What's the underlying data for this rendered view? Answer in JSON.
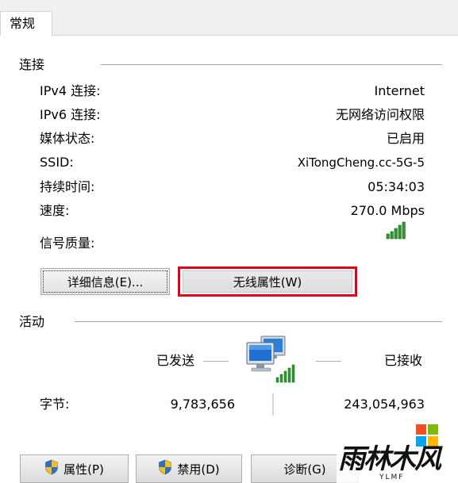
{
  "tab": {
    "label": "常规"
  },
  "connection": {
    "title": "连接",
    "rows": [
      {
        "label": "IPv4 连接:",
        "value": "Internet"
      },
      {
        "label": "IPv6 连接:",
        "value": "无网络访问权限"
      },
      {
        "label": "媒体状态:",
        "value": "已启用"
      },
      {
        "label": "SSID:",
        "value": "XiTongCheng.cc-5G-5"
      },
      {
        "label": "持续时间:",
        "value": "05:34:03"
      },
      {
        "label": "速度:",
        "value": "270.0 Mbps"
      }
    ],
    "signal_label": "信号质量:",
    "signal_icon": "signal-strength-icon",
    "signal_bars": 5,
    "details_button": "详细信息(E)...",
    "wireless_button": "无线属性(W)"
  },
  "activity": {
    "title": "活动",
    "sent_label": "已发送",
    "received_label": "已接收",
    "bytes_label": "字节:",
    "bytes_sent": "9,783,656",
    "bytes_received": "243,054,963",
    "network_icon": "network-computers-icon"
  },
  "buttons": {
    "properties": "属性(P)",
    "disable": "禁用(D)",
    "diagnose": "诊断(G)"
  },
  "watermark": {
    "brand": "雨林木风",
    "sub": "YLMF"
  },
  "colors": {
    "highlight": "#e0001b",
    "signal": "#2e9a2e",
    "shield_blue": "#2f6fc6",
    "shield_yellow": "#f2c118"
  }
}
